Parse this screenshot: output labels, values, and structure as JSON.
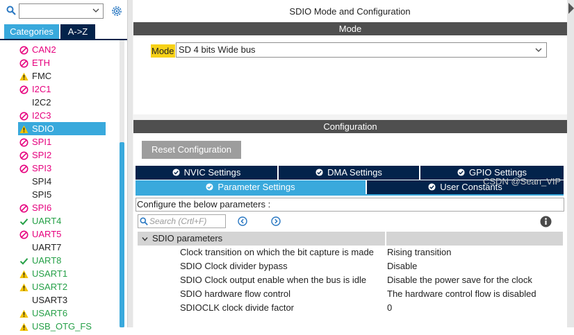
{
  "left": {
    "search": {
      "value": ""
    },
    "tabs": {
      "categories": "Categories",
      "az": "A->Z"
    },
    "items": [
      {
        "label": "CAN2",
        "status": "disabled"
      },
      {
        "label": "ETH",
        "status": "disabled"
      },
      {
        "label": "FMC",
        "status": "warning"
      },
      {
        "label": "I2C1",
        "status": "disabled"
      },
      {
        "label": "I2C2",
        "status": "none"
      },
      {
        "label": "I2C3",
        "status": "disabled"
      },
      {
        "label": "SDIO",
        "status": "warning",
        "selected": true
      },
      {
        "label": "SPI1",
        "status": "disabled"
      },
      {
        "label": "SPI2",
        "status": "disabled"
      },
      {
        "label": "SPI3",
        "status": "disabled"
      },
      {
        "label": "SPI4",
        "status": "none"
      },
      {
        "label": "SPI5",
        "status": "none"
      },
      {
        "label": "SPI6",
        "status": "disabled"
      },
      {
        "label": "UART4",
        "status": "ok"
      },
      {
        "label": "UART5",
        "status": "disabled"
      },
      {
        "label": "UART7",
        "status": "none"
      },
      {
        "label": "UART8",
        "status": "ok"
      },
      {
        "label": "USART1",
        "status": "warning"
      },
      {
        "label": "USART2",
        "status": "warning"
      },
      {
        "label": "USART3",
        "status": "none"
      },
      {
        "label": "USART6",
        "status": "warning"
      },
      {
        "label": "USB_OTG_FS",
        "status": "warning"
      }
    ]
  },
  "main": {
    "title": "SDIO Mode and Configuration",
    "mode_header": "Mode",
    "mode_label": "Mode",
    "mode_value": "SD 4 bits Wide bus",
    "config_header": "Configuration",
    "reset_button": "Reset Configuration",
    "tabs": {
      "nvic": "NVIC Settings",
      "dma": "DMA Settings",
      "gpio": "GPIO Settings",
      "param": "Parameter Settings",
      "user_constants": "User Constants"
    },
    "info_text": "Configure the below parameters :",
    "search_placeholder": "Search (Crtl+F)",
    "group": "SDIO parameters",
    "params": [
      {
        "name": "Clock transition on which the bit capture is made",
        "value": "Rising transition"
      },
      {
        "name": "SDIO Clock divider bypass",
        "value": "Disable"
      },
      {
        "name": "SDIO Clock output enable when the bus is idle",
        "value": "Disable the power save for the clock"
      },
      {
        "name": "SDIO hardware flow control",
        "value": "The hardware control flow is disabled"
      },
      {
        "name": "SDIOCLK clock divide factor",
        "value": "0"
      }
    ]
  },
  "watermark": "CSDN @Sean_VIP",
  "colors": {
    "accent_blue": "#39a9dc",
    "dark_navy": "#03234b",
    "header_gray": "#4f4f4f",
    "mode_highlight": "#f7d117",
    "disabled_pink": "#e6007e",
    "ok_green": "#25a047",
    "warning_yellow": "#f3c300"
  },
  "icons": {
    "disabled": "prohibited-icon",
    "warning": "warning-triangle-icon",
    "ok": "check-icon"
  }
}
